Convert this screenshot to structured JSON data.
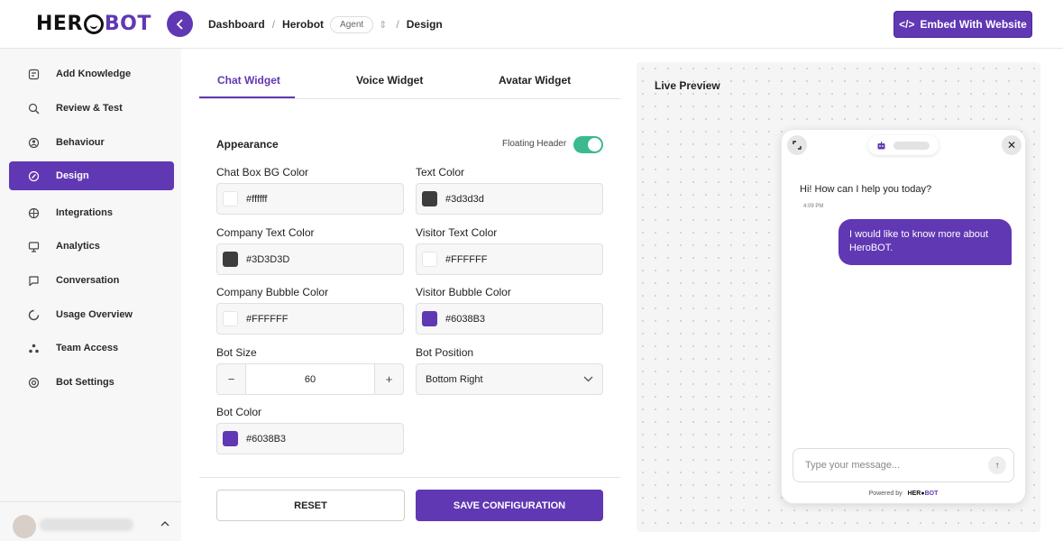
{
  "brand": {
    "logo_left": "HER",
    "logo_right": "BOT"
  },
  "breadcrumb": {
    "dashboard": "Dashboard",
    "bot": "Herobot",
    "agent": "Agent",
    "page": "Design"
  },
  "header": {
    "embed_label": "Embed With Website"
  },
  "sidebar": {
    "items": [
      {
        "label": "Add Knowledge",
        "icon": "add-knowledge-icon"
      },
      {
        "label": "Review & Test",
        "icon": "review-icon"
      },
      {
        "label": "Behaviour",
        "icon": "behaviour-icon"
      },
      {
        "label": "Design",
        "icon": "design-icon",
        "active": true
      },
      {
        "label": "Integrations",
        "icon": "integrations-icon"
      },
      {
        "label": "Analytics",
        "icon": "analytics-icon"
      },
      {
        "label": "Conversation",
        "icon": "conversation-icon"
      },
      {
        "label": "Usage Overview",
        "icon": "usage-icon"
      },
      {
        "label": "Team Access",
        "icon": "team-icon"
      },
      {
        "label": "Bot Settings",
        "icon": "settings-icon"
      }
    ]
  },
  "tabs": [
    {
      "label": "Chat Widget",
      "active": true
    },
    {
      "label": "Voice Widget"
    },
    {
      "label": "Avatar Widget"
    }
  ],
  "form": {
    "section_title": "Appearance",
    "floating_header_label": "Floating Header",
    "floating_header_on": true,
    "chat_bg": {
      "label": "Chat Box BG Color",
      "value": "#ffffff"
    },
    "text_color": {
      "label": "Text Color",
      "value": "#3d3d3d"
    },
    "company_text": {
      "label": "Company Text Color",
      "value": "#3D3D3D"
    },
    "visitor_text": {
      "label": "Visitor Text Color",
      "value": "#FFFFFF"
    },
    "company_bubble": {
      "label": "Company Bubble Color",
      "value": "#FFFFFF"
    },
    "visitor_bubble": {
      "label": "Visitor Bubble Color",
      "value": "#6038B3"
    },
    "bot_size": {
      "label": "Bot Size",
      "value": "60",
      "minus": "−",
      "plus": "+"
    },
    "bot_position": {
      "label": "Bot Position",
      "value": "Bottom Right"
    },
    "bot_color": {
      "label": "Bot Color",
      "value": "#6038B3"
    },
    "reset_label": "RESET",
    "save_label": "SAVE CONFIGURATION"
  },
  "preview": {
    "title": "Live Preview",
    "greeting": "Hi! How can I help you today?",
    "greeting_time": "4:09 PM",
    "user_message": "I would like to know more about HeroBOT.",
    "input_placeholder": "Type your message...",
    "powered_by": "Powered by",
    "powered_brand_left": "HER",
    "powered_brand_right": "BOT"
  },
  "colors": {
    "accent": "#6038B3",
    "toggle_on": "#3bb990"
  }
}
